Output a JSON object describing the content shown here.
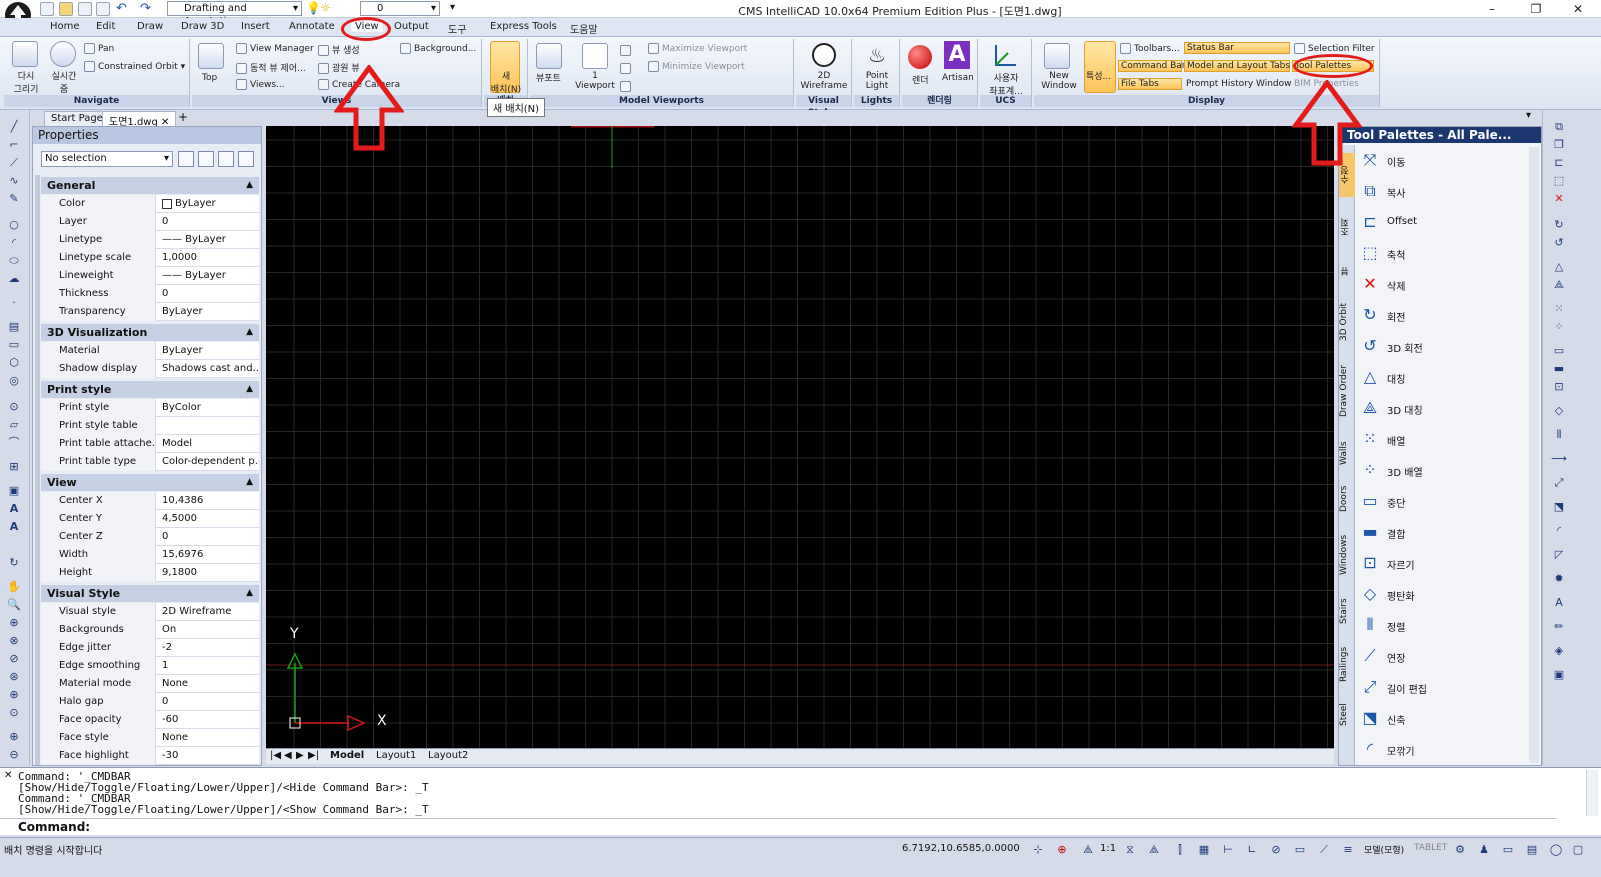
{
  "titlebar": {
    "title": "CMS IntelliCAD 10.0x64 Premium Edition Plus  - [도면1.dwg]",
    "workspace": "Drafting and Annotation",
    "layer_value": "0",
    "minimize": "–",
    "maximize": "❐",
    "close": "✕"
  },
  "tabs": [
    "Home",
    "Edit",
    "Draw",
    "Draw 3D",
    "Insert",
    "Annotate",
    "View",
    "Output",
    "도구",
    "Express Tools",
    "도움말"
  ],
  "ribbon": {
    "navigate": {
      "label": "Navigate",
      "redraw": "다시\n그리기",
      "realtime": "실시간\n줌",
      "pan": "Pan",
      "orbit": "Constrained Orbit"
    },
    "views": {
      "label": "Views",
      "top": "Top",
      "view_manager": "View Manager",
      "dynamic_view": "동적 뷰 제어...",
      "views": "Views...",
      "named_view": "뷰 생성",
      "light_view": "광원 뷰",
      "create_camera": "Create Camera",
      "background": "Background..."
    },
    "layout": {
      "new_layout": "새\n배치(N)",
      "tooltip": "새 배치(N)",
      "panel_label": "배치"
    },
    "model_viewports": {
      "label": "Model Viewports",
      "viewport": "뷰포트",
      "one_viewport": "1\nViewport",
      "maximize": "Maximize Viewport",
      "minimize": "Minimize Viewport"
    },
    "visual_styles": {
      "label": "Visual Styles",
      "wireframe": "2D\nWireframe"
    },
    "lights": {
      "label": "Lights",
      "point_light": "Point\nLight"
    },
    "render": {
      "label": "렌더링",
      "render": "렌더",
      "artisan": "Artisan"
    },
    "ucs": {
      "label": "UCS",
      "user_coords": "사용자\n좌표계..."
    },
    "display": {
      "label": "Display",
      "new_window": "New\nWindow",
      "properties": "특성...",
      "toolbars": "Toolbars...",
      "command_bar": "Command Bar",
      "file_tabs": "File Tabs",
      "status_bar": "Status Bar",
      "model_layout_tabs": "Model and Layout Tabs",
      "prompt_history": "Prompt History Window",
      "selection_filter": "Selection Filter",
      "tool_palettes": "Tool Palettes",
      "bim_properties": "BIM Properties"
    }
  },
  "doctabs": [
    "Start Page",
    "도면1.dwg"
  ],
  "properties": {
    "title": "Properties",
    "selection": "No selection",
    "groups": [
      {
        "name": "General",
        "rows": [
          [
            "Color",
            "ByLayer"
          ],
          [
            "Layer",
            "0"
          ],
          [
            "Linetype",
            "—— ByLayer"
          ],
          [
            "Linetype scale",
            "1,0000"
          ],
          [
            "Lineweight",
            "—— ByLayer"
          ],
          [
            "Thickness",
            "0"
          ],
          [
            "Transparency",
            "ByLayer"
          ]
        ]
      },
      {
        "name": "3D Visualization",
        "rows": [
          [
            "Material",
            "ByLayer"
          ],
          [
            "Shadow display",
            "Shadows cast and..."
          ]
        ]
      },
      {
        "name": "Print style",
        "rows": [
          [
            "Print style",
            "ByColor"
          ],
          [
            "Print style table",
            ""
          ],
          [
            "Print table attache...",
            "Model"
          ],
          [
            "Print table type",
            "Color-dependent p..."
          ]
        ]
      },
      {
        "name": "View",
        "rows": [
          [
            "Center X",
            "10,4386"
          ],
          [
            "Center Y",
            "4,5000"
          ],
          [
            "Center Z",
            "0"
          ],
          [
            "Width",
            "15,6976"
          ],
          [
            "Height",
            "9,1800"
          ]
        ]
      },
      {
        "name": "Visual Style",
        "rows": [
          [
            "Visual style",
            "2D Wireframe"
          ],
          [
            "Backgrounds",
            "On"
          ],
          [
            "Edge jitter",
            "-2"
          ],
          [
            "Edge smoothing",
            "1"
          ],
          [
            "Material mode",
            "None"
          ],
          [
            "Halo gap",
            "0"
          ],
          [
            "Face opacity",
            "-60"
          ],
          [
            "Face style",
            "None"
          ],
          [
            "Face highlight",
            "-30"
          ]
        ]
      }
    ]
  },
  "canvas": {
    "axis_y": "Y",
    "axis_x": "X"
  },
  "layout_tabs": [
    "Model",
    "Layout1",
    "Layout2"
  ],
  "tool_palettes": {
    "title": "Tool Palettes - All Pale...",
    "side_tabs": [
      "수정",
      "조회",
      "뷰",
      "3D Orbit",
      "Draw Order",
      "Walls",
      "Doors",
      "Windows",
      "Stairs",
      "Railings",
      "Steel"
    ],
    "items": [
      "이동",
      "복사",
      "Offset",
      "축척",
      "삭제",
      "회전",
      "3D 회전",
      "대칭",
      "3D 대칭",
      "배열",
      "3D 배열",
      "중단",
      "결합",
      "자르기",
      "평탄화",
      "정렬",
      "연장",
      "길이 편집",
      "신축",
      "모깎기"
    ]
  },
  "command": {
    "lines": [
      "Command: '_CMDBAR",
      "[Show/Hide/Toggle/Floating/Lower/Upper]/<Hide Command Bar>: _T",
      "Command: '_CMDBAR",
      "[Show/Hide/Toggle/Floating/Lower/Upper]/<Show Command Bar>: _T"
    ],
    "prompt": "Command:"
  },
  "status": {
    "message": "배치 명령을 시작합니다",
    "coords": "6.7192,10.6585,0.0000",
    "scale": "1:1",
    "model": "모델(모형)",
    "tablet": "TABLET"
  },
  "annotation_color": "#e31b1b"
}
